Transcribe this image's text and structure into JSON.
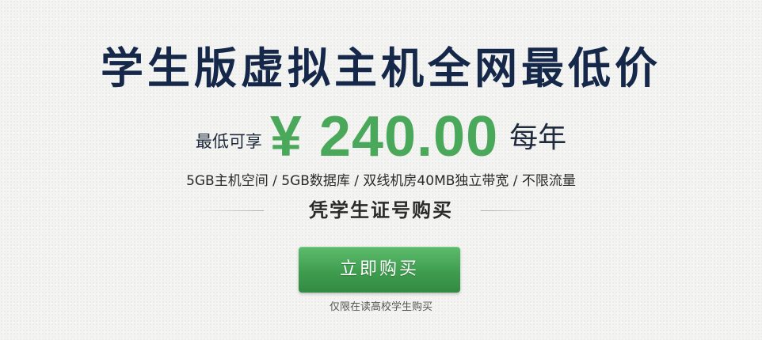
{
  "banner": {
    "headline": "学生版虚拟主机全网最低价",
    "price": {
      "prefix": "最低可享",
      "value": "¥ 240.00",
      "suffix": "每年"
    },
    "features": "5GB主机空间 / 5GB数据库 / 双线机房40MB独立带宽 / 不限流量",
    "subtitle": "凭学生证号购买",
    "buy_button_label": "立即购买",
    "note": "仅限在读高校学生购买"
  },
  "colors": {
    "headline": "#15284a",
    "price": "#4aa85b",
    "button": "#3f9d4f"
  }
}
